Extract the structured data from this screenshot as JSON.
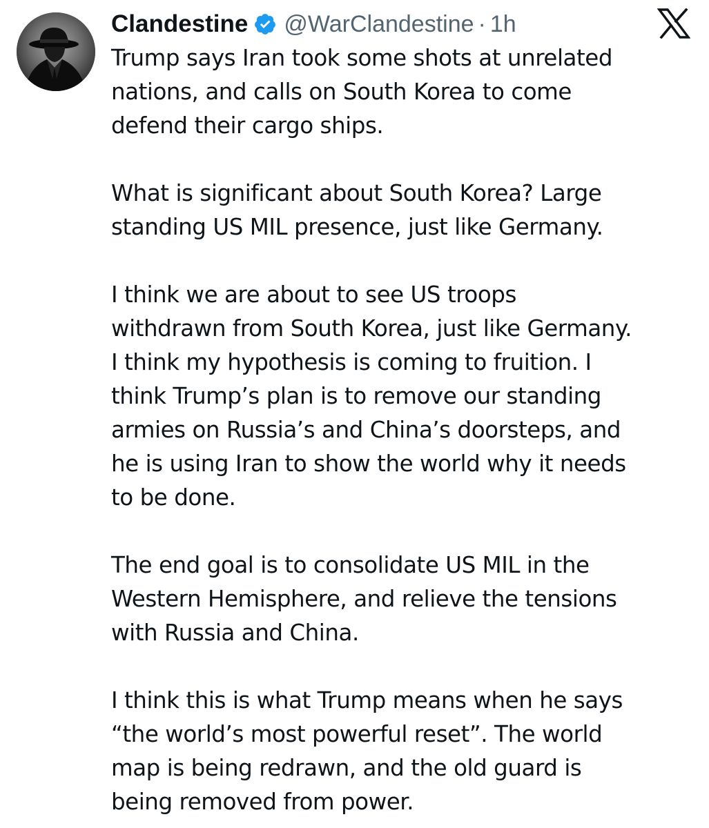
{
  "tweet": {
    "author": {
      "display_name": "Clandestine",
      "handle": "@WarClandestine",
      "separator": "·",
      "time": "1h",
      "verified_color": "#1d9bf0"
    },
    "avatar_icon": "fedora-silhouette-avatar",
    "platform_icon": "x-logo-icon",
    "paragraphs": [
      [
        "Trump says Iran took some shots at unrelated",
        "nations, and calls on South Korea to come",
        "defend their cargo ships."
      ],
      [
        "What is significant about South Korea? Large",
        "standing US MIL presence, just like Germany."
      ],
      [
        "I think we are about to see US troops",
        "withdrawn from South Korea, just like Germany.",
        "I think my hypothesis is coming to fruition. I",
        "think Trump’s plan is to remove our standing",
        "armies on Russia’s and China’s doorsteps, and",
        "he is using Iran to show the world why it needs",
        "to be done."
      ],
      [
        "The end goal is to consolidate US MIL in the",
        "Western Hemisphere, and relieve the tensions",
        "with Russia and China."
      ],
      [
        "I think this is what Trump means when he says",
        "“the world’s most powerful reset”. The world",
        "map is being redrawn, and the old guard is",
        "being removed from power."
      ]
    ]
  }
}
